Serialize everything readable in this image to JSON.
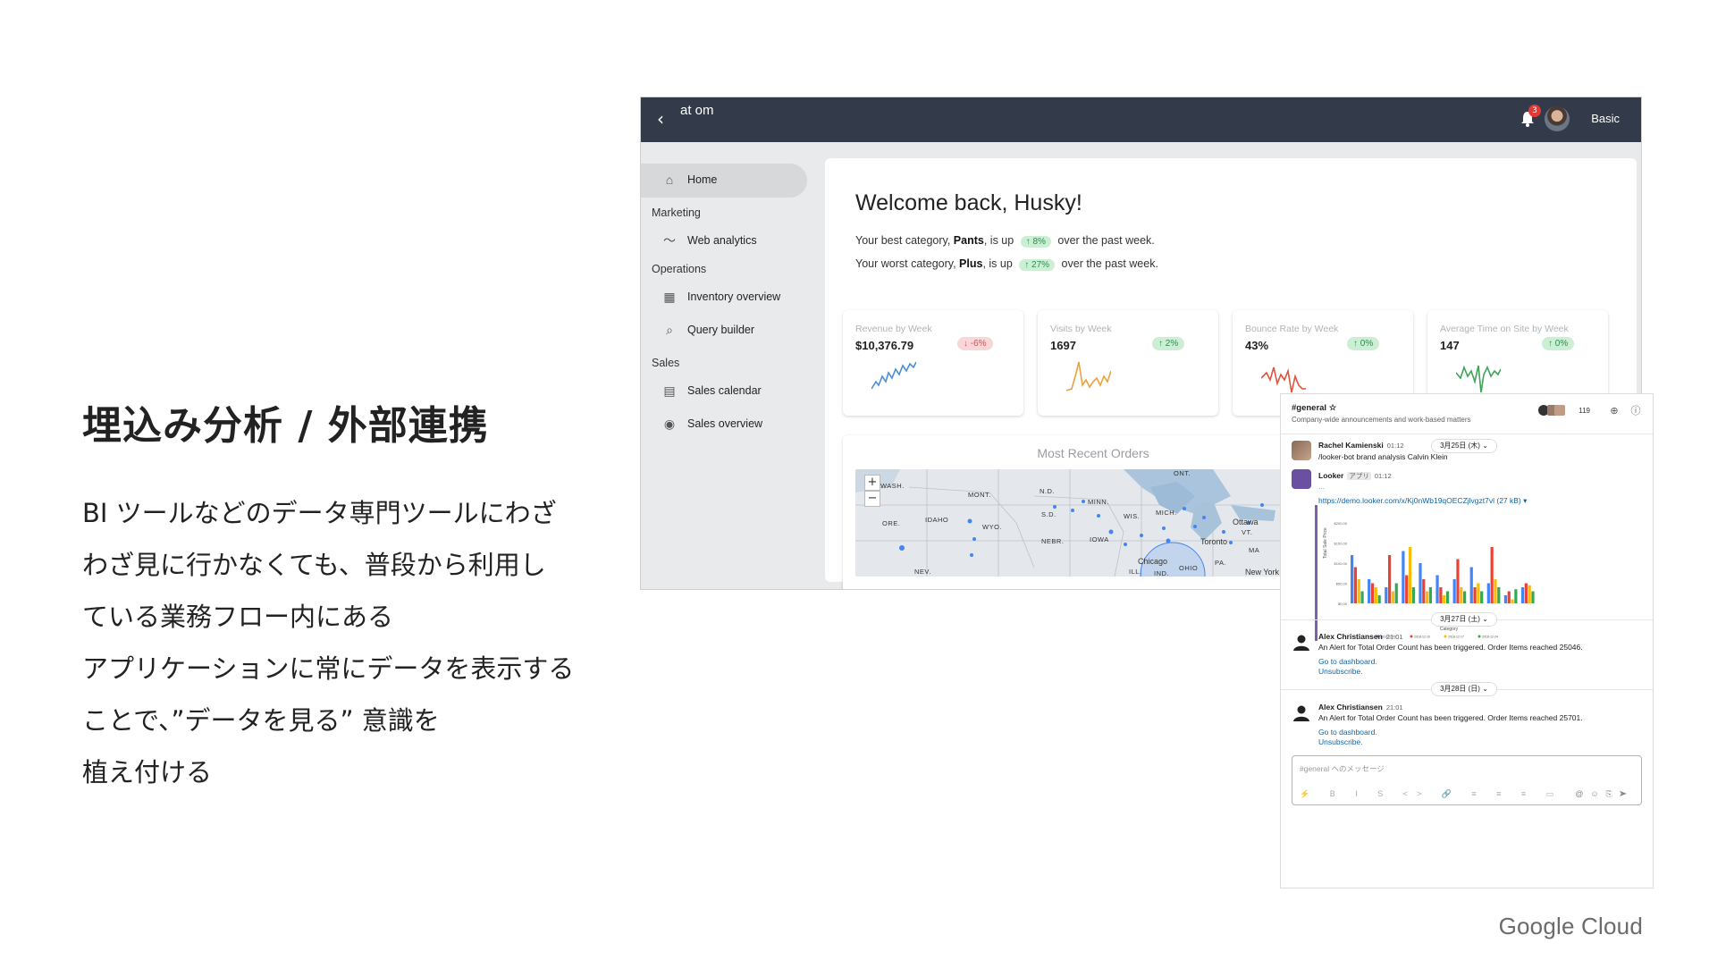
{
  "slide": {
    "heading": "埋込み分析 / 外部連携",
    "body_lines": [
      "BI ツールなどのデータ専門ツールにわざ",
      "わざ見に行かなくても、普段から利用し",
      "ている業務フロー内にある",
      "アプリケーションに常にデータを表示する",
      "ことで、”データを見る” 意識を",
      "植え付ける"
    ],
    "brand": "Google Cloud"
  },
  "app": {
    "logo": "at om",
    "notification_count": "3",
    "user_name": "Basic",
    "nav": {
      "home": "Home",
      "marketing_section": "Marketing",
      "web_analytics": "Web analytics",
      "operations_section": "Operations",
      "inventory_overview": "Inventory overview",
      "query_builder": "Query builder",
      "sales_section": "Sales",
      "sales_calendar": "Sales calendar",
      "sales_overview": "Sales overview"
    },
    "welcome": "Welcome back, Husky!",
    "insight_best": {
      "prefix": "Your best category, ",
      "category": "Pants",
      "middle": ", is up ",
      "delta": "↑ 8%",
      "suffix": " over the past week."
    },
    "insight_worst": {
      "prefix": "Your worst category, ",
      "category": "Plus",
      "middle": ", is up ",
      "delta": "↑ 27%",
      "suffix": " over the past week."
    },
    "cards": [
      {
        "title": "Revenue by Week",
        "value": "$10,376.79",
        "delta": "↓ -6%",
        "color": "#4a90d9",
        "delta_bg": "#f8d7da",
        "delta_fg": "#d9534f"
      },
      {
        "title": "Visits by Week",
        "value": "1697",
        "delta": "↑ 2%",
        "color": "#e8a33d",
        "delta_bg": "#ccefd4",
        "delta_fg": "#2e8b4f"
      },
      {
        "title": "Bounce Rate by Week",
        "value": "43%",
        "delta": "↑ 0%",
        "color": "#e0533f",
        "delta_bg": "#ccefd4",
        "delta_fg": "#2e8b4f"
      },
      {
        "title": "Average Time on Site by Week",
        "value": "147",
        "delta": "↑ 0%",
        "color": "#3fa35a",
        "delta_bg": "#ccefd4",
        "delta_fg": "#2e8b4f"
      }
    ],
    "orders_title": "Most Recent Orders",
    "map": {
      "zoom_in": "+",
      "zoom_out": "−",
      "labels": [
        "WASH.",
        "MONT.",
        "N.D.",
        "MINN.",
        "ONT.",
        "ORE.",
        "IDAHO",
        "WYO.",
        "S.D.",
        "WIS.",
        "MICH.",
        "NEBR.",
        "IOWA",
        "NEV.",
        "ILL.",
        "IND.",
        "OHIO",
        "PA.",
        "VT.",
        "MA"
      ],
      "cities": [
        "Ottawa",
        "Toronto",
        "Chicago",
        "New York"
      ]
    }
  },
  "slack": {
    "channel": "#general",
    "channel_desc": "Company-wide announcements and work-based matters",
    "member_count": "119",
    "date1": "3月25日 (木) ⌄",
    "msg1_name": "Rachel Kamienski",
    "msg1_time": "01:12",
    "msg1_text": "/looker-bot brand analysis Calvin Klein",
    "msg2_name": "Looker",
    "msg2_tag": "アプリ",
    "msg2_time": "01:12",
    "msg2_text": "...",
    "msg2_link": "https://demo.looker.com/x/Kj0nWb19qOECZjlvgzt7vl (27 kB) ▾",
    "date2": "3月27日 (土) ⌄",
    "msg3_name": "Alex Christiansen",
    "msg3_time": "21:01",
    "msg3_text": "An Alert for Total Order Count has been triggered. Order Items reached 25046.",
    "msg3_link1": "Go to dashboard.",
    "msg3_link2": "Unsubscribe.",
    "date3": "3月28日 (日) ⌄",
    "msg4_name": "Alex Christiansen",
    "msg4_time": "21:01",
    "msg4_text": "An Alert for Total Order Count has been triggered. Order Items reached 25701.",
    "msg4_link1": "Go to dashboard.",
    "msg4_link2": "Unsubscribe.",
    "input_placeholder": "#general へのメッセージ",
    "toolbar": "⚡ B I S <> 🔗 ≡ ≡ ≡ ▭"
  },
  "chart_data": {
    "type": "bar",
    "title": "",
    "xlabel": "Category",
    "ylabel": "Total Sale Price",
    "yticks": [
      "$0.00",
      "$50.00",
      "$100.00",
      "$150.00",
      "$200.00"
    ],
    "series_colors": [
      "#4285f4",
      "#ea4335",
      "#fbbc04",
      "#34a853"
    ],
    "series_names": [
      "2018-12-03",
      "2018-12-10",
      "2018-12-17",
      "2018-12-24"
    ],
    "values": [
      [
        120,
        90,
        60,
        30
      ],
      [
        60,
        50,
        40,
        20
      ],
      [
        40,
        120,
        30,
        50
      ],
      [
        130,
        70,
        140,
        40
      ],
      [
        100,
        60,
        30,
        40
      ],
      [
        70,
        40,
        20,
        30
      ],
      [
        60,
        110,
        40,
        30
      ],
      [
        90,
        40,
        50,
        30
      ],
      [
        50,
        140,
        60,
        40
      ],
      [
        20,
        30,
        10,
        35
      ],
      [
        40,
        50,
        45,
        30
      ]
    ]
  }
}
